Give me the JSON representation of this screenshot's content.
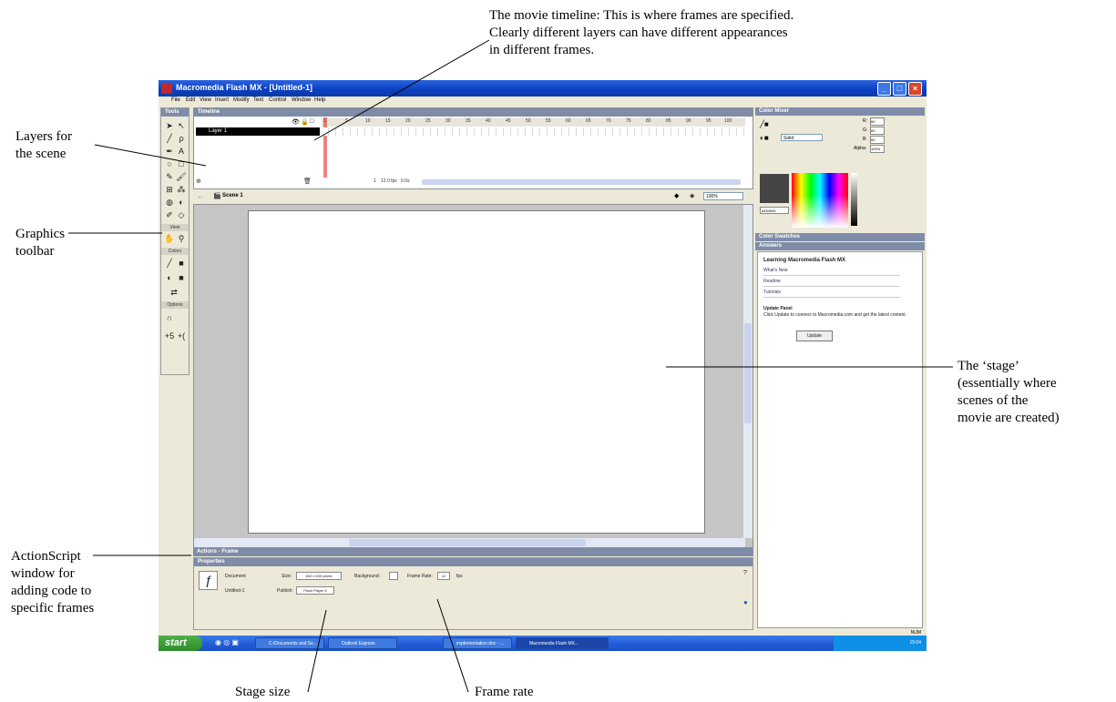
{
  "annotations": {
    "timeline": [
      "The movie timeline: This is where frames are specified.",
      "Clearly different layers can have different appearances",
      "in different frames."
    ],
    "layers": [
      "Layers for",
      "the scene"
    ],
    "graphics": [
      "Graphics",
      "toolbar"
    ],
    "stage": [
      "The ‘stage’",
      "(essentially where",
      "scenes of the",
      "movie are created)"
    ],
    "actionscript": [
      "ActionScript",
      "window for",
      "adding code to",
      "specific frames"
    ],
    "stage_size": "Stage size",
    "frame_rate": "Frame rate"
  },
  "window": {
    "title": "Macromedia Flash MX - [Untitled-1]",
    "menu": [
      "File",
      "Edit",
      "View",
      "Insert",
      "Modify",
      "Text",
      "Control",
      "Window",
      "Help"
    ]
  },
  "tools": {
    "title": "Tools",
    "view_label": "View",
    "colors_label": "Colors",
    "options_label": "Options"
  },
  "timeline": {
    "title": "Timeline",
    "layer_name": "Layer 1",
    "ruler": [
      "1",
      "5",
      "10",
      "15",
      "20",
      "25",
      "30",
      "35",
      "40",
      "45",
      "50",
      "55",
      "60",
      "65",
      "70",
      "75",
      "80",
      "85",
      "90",
      "95",
      "100"
    ],
    "current_frame": "1",
    "fps": "12.0 fps",
    "elapsed": "0.0s"
  },
  "editbar": {
    "scene": "Scene 1",
    "zoom": "100%"
  },
  "panels": {
    "actions": "Actions - Frame",
    "properties": "Properties",
    "color_mixer": "Color Mixer",
    "color_swatches": "Color Swatches",
    "answers": "Answers"
  },
  "properties": {
    "doc_label": "Document",
    "doc_name": "Untitled-1",
    "size_label": "Size:",
    "size_value": "800 x 600 pixels",
    "background_label": "Background:",
    "frame_rate_label": "Frame Rate:",
    "frame_rate_value": "12",
    "fps_unit": "fps",
    "publish_label": "Publish:",
    "publish_value": "Flash Player 6"
  },
  "color_mixer": {
    "fill_type": "Solid",
    "r_label": "R:",
    "r": "69",
    "g_label": "G:",
    "g": "69",
    "b_label": "B:",
    "b": "69",
    "alpha_label": "Alpha:",
    "alpha": "100%",
    "hex": "#454545",
    "swatch_color": "#454545"
  },
  "answers": {
    "heading": "Learning Macromedia Flash MX",
    "links": [
      "What's New",
      "Readme",
      "Tutorials"
    ],
    "update_title": "Update Panel",
    "update_text": "Click Update to connect to Macromedia.com and get the latest content.",
    "update_button": "Update"
  },
  "taskbar": {
    "start": "start",
    "tasks": [
      "C:\\Documents and Se...",
      "Outlook Express",
      "implementation.doc - ...",
      "Macromedia Flash MX..."
    ],
    "num": "NUM",
    "clock": "15:04"
  }
}
